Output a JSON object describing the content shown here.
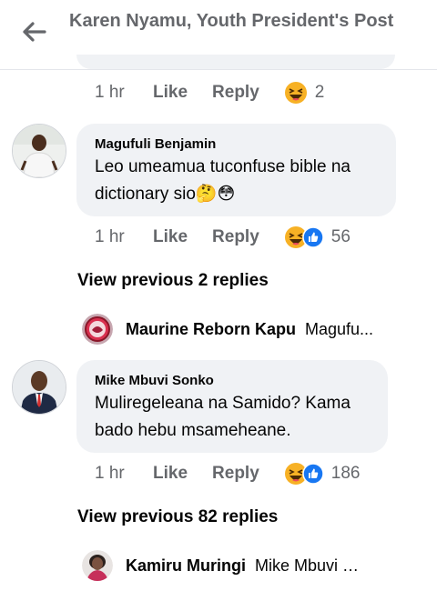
{
  "header": {
    "title": "Karen Nyamu, Youth President's Post"
  },
  "previous_comment": {
    "time": "1 hr",
    "like_label": "Like",
    "reply_label": "Reply",
    "reaction_count": "2",
    "reaction_icons": [
      "haha-icon"
    ]
  },
  "comments": [
    {
      "author": "Magufuli Benjamin",
      "text": "Leo umeamua tuconfuse bible na dictionary sio🤔😳",
      "time": "1 hr",
      "like_label": "Like",
      "reply_label": "Reply",
      "reaction_count": "56",
      "reaction_icons": [
        "haha-icon",
        "like-icon"
      ],
      "view_previous": "View previous 2 replies",
      "latest_reply": {
        "author": "Maurine Reborn Kapu",
        "snippet": "Magufu..."
      }
    },
    {
      "author": "Mike Mbuvi Sonko",
      "text": "Muliregeleana na Samido? Kama bado hebu msameheane.",
      "time": "1 hr",
      "like_label": "Like",
      "reply_label": "Reply",
      "reaction_count": "186",
      "reaction_icons": [
        "haha-icon",
        "like-icon"
      ],
      "view_previous": "View previous 82 replies",
      "latest_reply": {
        "author": "Kamiru Muringi",
        "snippet": "Mike Mbuvi S..."
      }
    }
  ],
  "colors": {
    "bubble": "#f0f2f5",
    "secondary_text": "#65676b",
    "like_blue": "#1877f2",
    "haha_yellow": "#f7b125"
  }
}
